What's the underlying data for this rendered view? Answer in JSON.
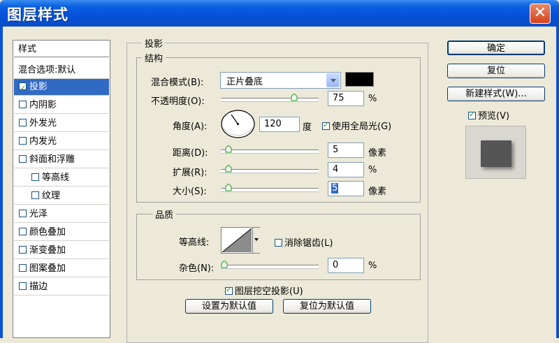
{
  "window": {
    "title": "图层样式",
    "close_glyph": "✕"
  },
  "style_list": {
    "header": "样式",
    "blending_options": "混合选项:默认",
    "items": [
      {
        "label": "投影",
        "checked": true,
        "selected": true
      },
      {
        "label": "内阴影",
        "checked": false
      },
      {
        "label": "外发光",
        "checked": false
      },
      {
        "label": "内发光",
        "checked": false
      },
      {
        "label": "斜面和浮雕",
        "checked": false
      },
      {
        "label": "等高线",
        "checked": false,
        "indent": true
      },
      {
        "label": "纹理",
        "checked": false,
        "indent": true
      },
      {
        "label": "光泽",
        "checked": false
      },
      {
        "label": "颜色叠加",
        "checked": false
      },
      {
        "label": "渐变叠加",
        "checked": false
      },
      {
        "label": "图案叠加",
        "checked": false
      },
      {
        "label": "描边",
        "checked": false
      }
    ]
  },
  "drop_shadow": {
    "title": "投影",
    "structure": {
      "title": "结构",
      "blend_mode_label": "混合模式(B):",
      "blend_mode_value": "正片叠底",
      "shadow_color": "#000000",
      "opacity_label": "不透明度(O):",
      "opacity_value": "75",
      "opacity_unit": "%",
      "opacity_level": 0.75,
      "angle_label": "角度(A):",
      "angle_value": "120",
      "angle_unit": "度",
      "use_global_light_label": "使用全局光(G)",
      "use_global_light_checked": true,
      "distance_label": "距离(D):",
      "distance_value": "5",
      "distance_unit": "像素",
      "spread_label": "扩展(R):",
      "spread_value": "4",
      "spread_unit": "%",
      "size_label": "大小(S):",
      "size_value": "5",
      "size_unit": "像素"
    },
    "quality": {
      "title": "品质",
      "contour_label": "等高线:",
      "anti_alias_label": "消除锯齿(L)",
      "anti_alias_checked": false,
      "noise_label": "杂色(N):",
      "noise_value": "0",
      "noise_unit": "%"
    },
    "knockout_label": "图层挖空投影(U)",
    "knockout_checked": true,
    "make_default_label": "设置为默认值",
    "reset_default_label": "复位为默认值"
  },
  "buttons": {
    "ok": "确定",
    "reset": "复位",
    "new_style": "新建样式(W)...",
    "preview_label": "预览(V)",
    "preview_checked": true
  },
  "colors": {
    "title_bar": "#0a5fe0",
    "selection": "#316ac5",
    "dialog_bg": "#ece9d8"
  }
}
